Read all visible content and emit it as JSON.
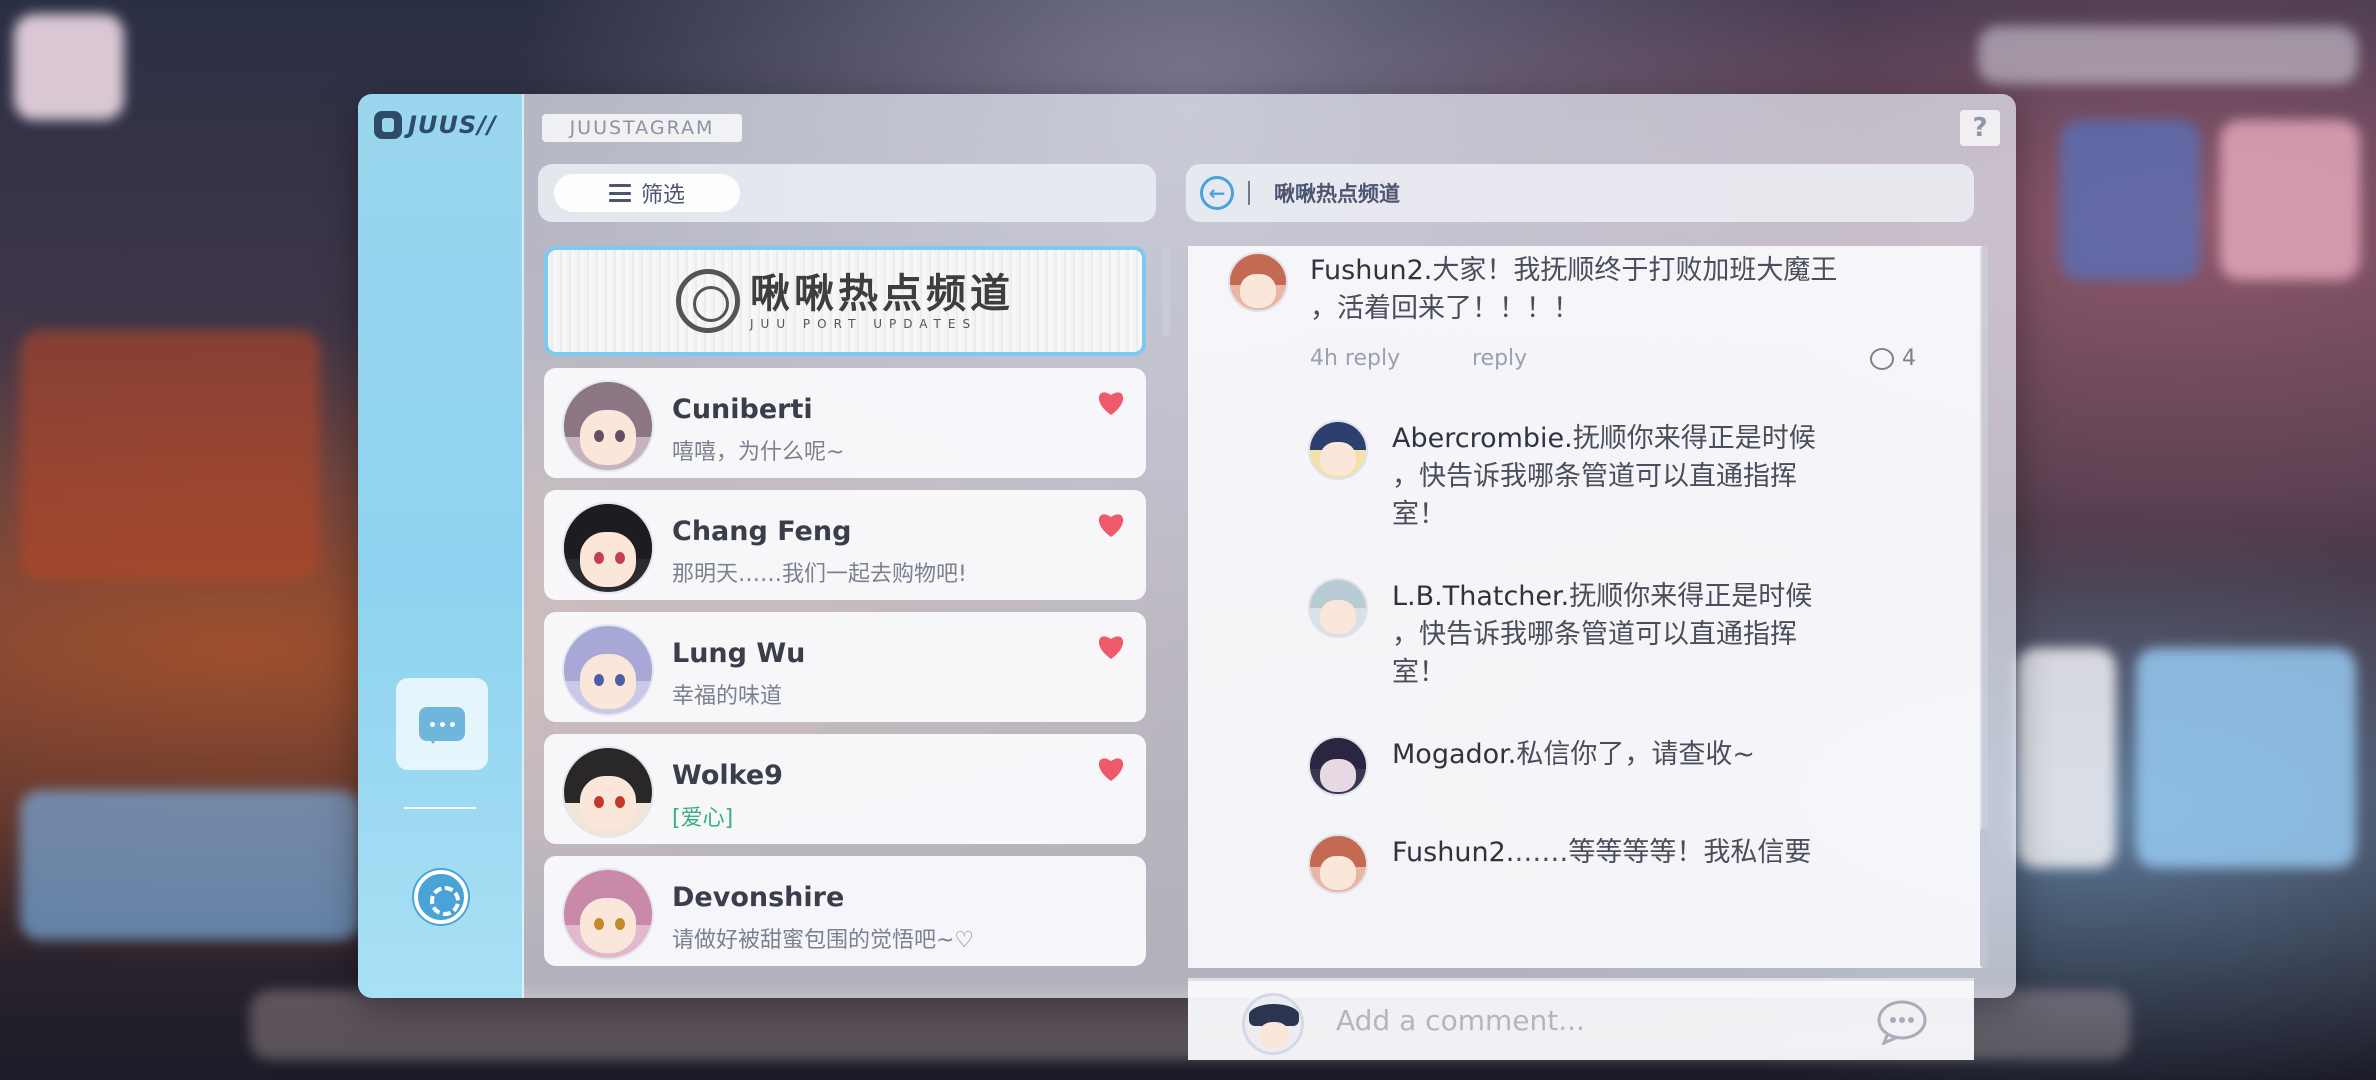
{
  "app": {
    "logo_text": "JUUS//",
    "title": "JUUSTAGRAM",
    "help_label": "?"
  },
  "filter": {
    "label": "筛选"
  },
  "channel": {
    "title_cn": "啾啾热点频道",
    "title_en": "JUU PORT UPDATES"
  },
  "contacts": [
    {
      "name": "Cuniberti",
      "message": "嘻嘻，为什么呢~",
      "favorited": true
    },
    {
      "name": "Chang Feng",
      "message": "那明天……我们一起去购物吧!",
      "favorited": true
    },
    {
      "name": "Lung Wu",
      "message": "幸福的味道",
      "favorited": true
    },
    {
      "name": "Wolke9",
      "message": "[爱心]",
      "favorited": true
    },
    {
      "name": "Devonshire",
      "message": "请做好被甜蜜包围的觉悟吧~♡",
      "favorited": false
    }
  ],
  "post": {
    "header_title": "啾啾热点频道",
    "main": {
      "author": "Fushun2.",
      "text_line1": "大家！我抚顺终于打败加班大魔王",
      "text_line2": "，活着回来了！！！！",
      "time": "4h reply",
      "reply_label": "reply",
      "comment_count": "4"
    },
    "replies": [
      {
        "author": "Abercrombie.",
        "lines": [
          "抚顺你来得正是时候",
          "，快告诉我哪条管道可以直通指挥",
          "室！"
        ]
      },
      {
        "author": "L.B.Thatcher.",
        "lines": [
          "抚顺你来得正是时候",
          "，快告诉我哪条管道可以直通指挥",
          "室！"
        ]
      },
      {
        "author": "Mogador.",
        "lines": [
          "私信你了，请查收~"
        ]
      },
      {
        "author": "Fushun2.",
        "lines": [
          "……等等等等！我私信要"
        ]
      }
    ]
  },
  "comment_box": {
    "placeholder": "Add a comment..."
  },
  "colors": {
    "accent_blue": "#4aa3d8",
    "heart_red": "#ee5a6a",
    "rail_blue": "#9ad6ee"
  }
}
